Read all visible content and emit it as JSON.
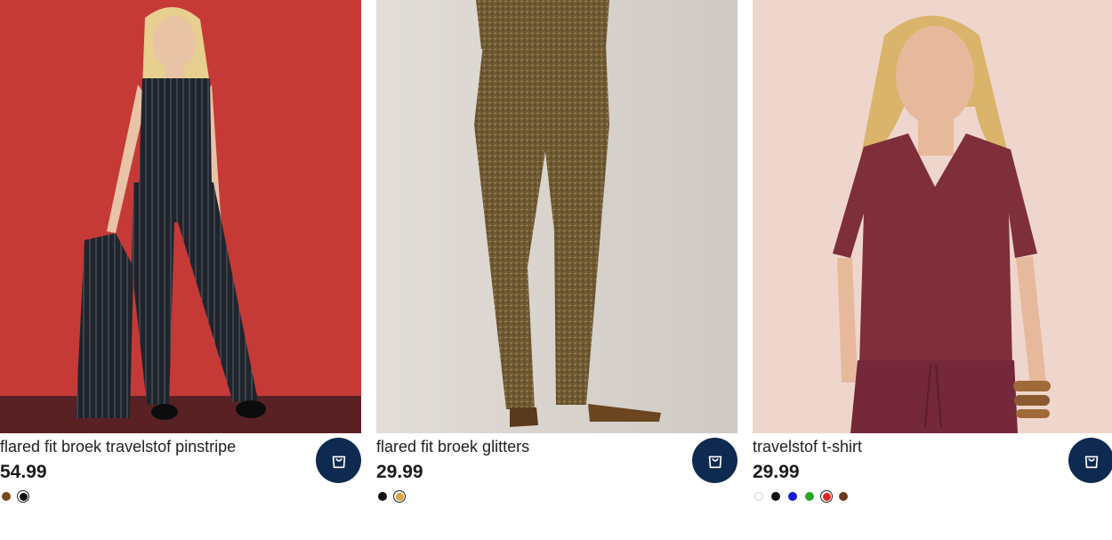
{
  "products": [
    {
      "name": "flared fit broek travelstof pinstripe",
      "price": "54.99",
      "cart_label": "add to cart",
      "colors": [
        {
          "hex": "#7a4a1a",
          "selected": false
        },
        {
          "hex": "#111111",
          "selected": true
        }
      ]
    },
    {
      "name": "flared fit broek glitters",
      "price": "29.99",
      "cart_label": "add to cart",
      "colors": [
        {
          "hex": "#111111",
          "selected": false
        },
        {
          "hex": "#d9a441",
          "selected": true
        }
      ]
    },
    {
      "name": "travelstof t-shirt",
      "price": "29.99",
      "cart_label": "add to cart",
      "colors": [
        {
          "hex": "#ffffff",
          "selected": false
        },
        {
          "hex": "#111111",
          "selected": false
        },
        {
          "hex": "#1a1ad6",
          "selected": false
        },
        {
          "hex": "#2aa52a",
          "selected": false
        },
        {
          "hex": "#e0231f",
          "selected": true
        },
        {
          "hex": "#6b3a1a",
          "selected": false
        }
      ]
    }
  ],
  "theme": {
    "cart_button": "#0f2a50"
  }
}
